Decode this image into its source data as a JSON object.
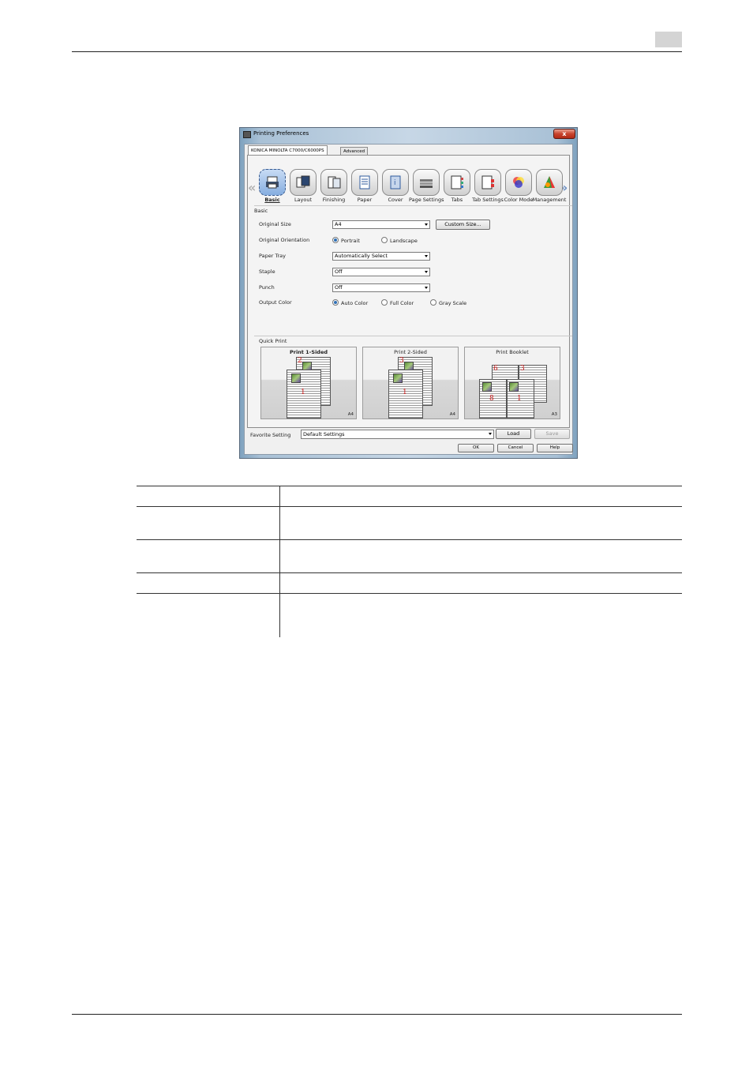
{
  "page": {
    "page_indicator": ""
  },
  "dialog": {
    "title": "Printing Preferences",
    "close_label": "x",
    "tabs": [
      {
        "label": "KONICA MINOLTA C7000/C6000PS",
        "selected": true
      },
      {
        "label": "Advanced",
        "selected": false
      }
    ],
    "toolbar": {
      "items": [
        {
          "label": "Basic",
          "icon": "basic-icon",
          "selected": true
        },
        {
          "label": "Layout",
          "icon": "layout-icon"
        },
        {
          "label": "Finishing",
          "icon": "finishing-icon"
        },
        {
          "label": "Paper",
          "icon": "paper-icon"
        },
        {
          "label": "Cover",
          "icon": "cover-icon"
        },
        {
          "label": "Page Settings",
          "icon": "page-settings-icon"
        },
        {
          "label": "Tabs",
          "icon": "tabs-icon"
        },
        {
          "label": "Tab Settings",
          "icon": "tab-settings-icon"
        },
        {
          "label": "Color Mode",
          "icon": "color-mode-icon"
        },
        {
          "label": "Management",
          "icon": "management-icon"
        }
      ]
    },
    "basic": {
      "group_label": "Basic",
      "original_size": {
        "label": "Original Size",
        "value": "A4",
        "custom_button": "Custom Size..."
      },
      "original_orientation": {
        "label": "Original Orientation",
        "options": [
          "Portrait",
          "Landscape"
        ],
        "selected": "Portrait"
      },
      "paper_tray": {
        "label": "Paper Tray",
        "value": "Automatically Select"
      },
      "staple": {
        "label": "Staple",
        "value": "Off"
      },
      "punch": {
        "label": "Punch",
        "value": "Off"
      },
      "output_color": {
        "label": "Output Color",
        "options": [
          "Auto Color",
          "Full Color",
          "Gray Scale"
        ],
        "selected": "Auto Color"
      }
    },
    "quick_print": {
      "group_label": "Quick Print",
      "items": [
        {
          "title": "Print 1-Sided",
          "size": "A4",
          "bold": true,
          "pages": [
            "2",
            "1"
          ]
        },
        {
          "title": "Print 2-Sided",
          "size": "A4",
          "pages": [
            "3",
            "1"
          ]
        },
        {
          "title": "Print Booklet",
          "size": "A3",
          "pages": [
            "6",
            "3",
            "8",
            "1"
          ]
        }
      ]
    },
    "favorite": {
      "label": "Favorite Setting",
      "value": "Default Settings",
      "load_button": "Load",
      "save_button": "Save"
    },
    "buttons": {
      "ok": "OK",
      "cancel": "Cancel",
      "help": "Help"
    }
  },
  "colors": {
    "accent": "#6c8fc2",
    "close": "#c8422c",
    "page_number_red": "#c81414"
  }
}
